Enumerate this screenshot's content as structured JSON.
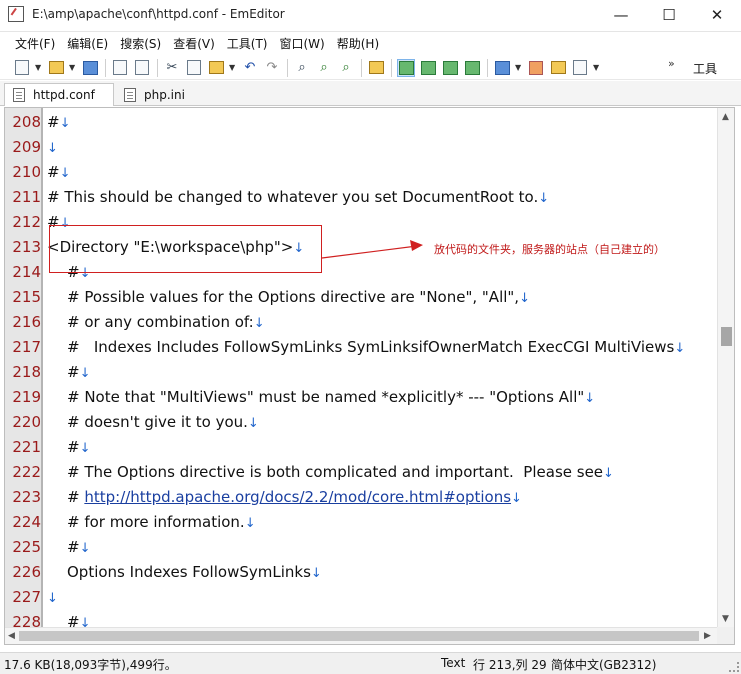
{
  "window": {
    "title": "E:\\amp\\apache\\conf\\httpd.conf - EmEditor",
    "minimize": "—",
    "maximize": "☐",
    "close": "✕"
  },
  "menu": [
    "文件(F)",
    "编辑(E)",
    "搜索(S)",
    "查看(V)",
    "工具(T)",
    "窗口(W)",
    "帮助(H)"
  ],
  "toolbar": {
    "tools_label": "工具",
    "overflow": "»"
  },
  "tabs": [
    {
      "label": "httpd.conf",
      "active": true
    },
    {
      "label": "php.ini",
      "active": false
    }
  ],
  "editor": {
    "lines": [
      {
        "n": "208",
        "text": "#",
        "indent": false
      },
      {
        "n": "209",
        "text": "",
        "indent": false
      },
      {
        "n": "210",
        "text": "#",
        "indent": false
      },
      {
        "n": "211",
        "text": "# This should be changed to whatever you set DocumentRoot to.",
        "indent": false
      },
      {
        "n": "212",
        "text": "#",
        "indent": false
      },
      {
        "n": "213",
        "text": "<Directory \"E:\\workspace\\php\">",
        "indent": false
      },
      {
        "n": "214",
        "text": "#",
        "indent": true
      },
      {
        "n": "215",
        "text": "# Possible values for the Options directive are \"None\", \"All\",",
        "indent": true
      },
      {
        "n": "216",
        "text": "# or any combination of:",
        "indent": true
      },
      {
        "n": "217",
        "text": "#   Indexes Includes FollowSymLinks SymLinksifOwnerMatch ExecCGI MultiViews",
        "indent": true
      },
      {
        "n": "218",
        "text": "#",
        "indent": true
      },
      {
        "n": "219",
        "text": "# Note that \"MultiViews\" must be named *explicitly* --- \"Options All\"",
        "indent": true
      },
      {
        "n": "220",
        "text": "# doesn't give it to you.",
        "indent": true
      },
      {
        "n": "221",
        "text": "#",
        "indent": true
      },
      {
        "n": "222",
        "text": "# The Options directive is both complicated and important.  Please see",
        "indent": true
      },
      {
        "n": "223",
        "text": "# ",
        "link": "http://httpd.apache.org/docs/2.2/mod/core.html#options",
        "indent": true
      },
      {
        "n": "224",
        "text": "# for more information.",
        "indent": true
      },
      {
        "n": "225",
        "text": "#",
        "indent": true
      },
      {
        "n": "226",
        "text": "Options Indexes FollowSymLinks",
        "indent": true
      },
      {
        "n": "227",
        "text": "",
        "indent": false
      },
      {
        "n": "228",
        "text": "#",
        "indent": true
      }
    ],
    "newline_glyph": "↓"
  },
  "annotation": {
    "text": "放代码的文件夹，服务器的站点（自己建立的）",
    "color": "#c01818"
  },
  "status": {
    "file_info": "17.6 KB(18,093字节),499行。",
    "mode": "Text",
    "position": "行 213,列 29",
    "encoding": "简体中文(GB2312)"
  }
}
